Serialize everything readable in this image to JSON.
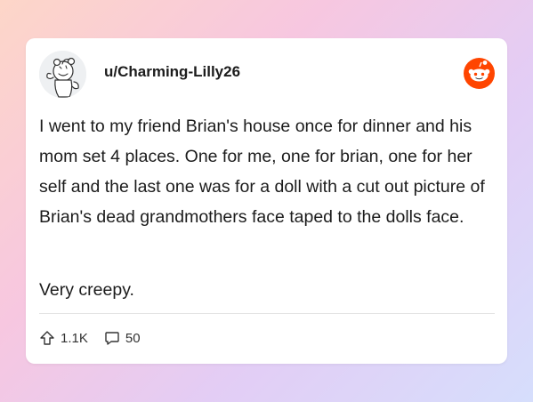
{
  "post": {
    "username": "u/Charming-Lilly26",
    "body_paragraph_1": "I went to my friend Brian's house once for dinner and his mom set 4 places. One for me, one for brian, one for her self and the last one was for a doll with a cut out picture of Brian's dead grandmothers face taped to the dolls face.",
    "body_paragraph_2": "Very creepy."
  },
  "stats": {
    "upvotes": "1.1K",
    "comments": "50"
  },
  "icons": {
    "avatar": "snoo-avatar-icon",
    "brand": "reddit-logo-icon",
    "upvote": "upvote-arrow-icon",
    "comment": "comment-bubble-icon"
  },
  "colors": {
    "reddit_orange": "#ff4500",
    "text": "#1c1c1c"
  }
}
